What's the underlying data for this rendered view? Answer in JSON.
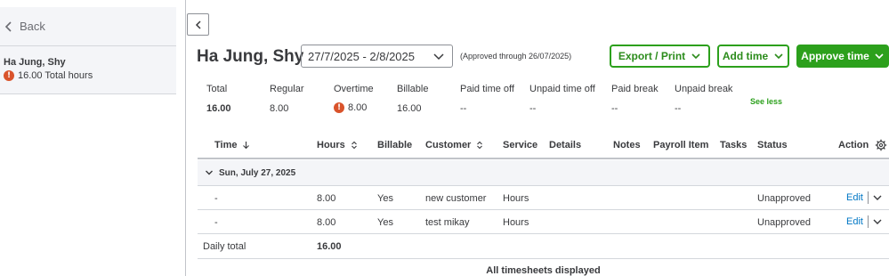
{
  "sidebar": {
    "back_label": "Back",
    "employee": {
      "name": "Ha Jung, Shy",
      "hours": "16.00 Total hours"
    }
  },
  "header": {
    "title": "Ha Jung, Shy",
    "date_range": "27/7/2025 - 2/8/2025",
    "approved_note": "(Approved through 26/07/2025)",
    "export_label": "Export / Print",
    "add_time_label": "Add time",
    "approve_label": "Approve time"
  },
  "summary": {
    "items": [
      {
        "label": "Total",
        "value": "16.00"
      },
      {
        "label": "Regular",
        "value": "8.00"
      },
      {
        "label": "Overtime",
        "value": "8.00"
      },
      {
        "label": "Billable",
        "value": "16.00"
      },
      {
        "label": "Paid time off",
        "value": "--"
      },
      {
        "label": "Unpaid time off",
        "value": "--"
      },
      {
        "label": "Paid break",
        "value": "--"
      },
      {
        "label": "Unpaid break",
        "value": "--"
      }
    ],
    "see_less": "See less"
  },
  "table": {
    "columns": [
      "Time",
      "Hours",
      "Billable",
      "Customer",
      "Service",
      "Details",
      "Notes",
      "Payroll Item",
      "Tasks",
      "Status",
      "Action"
    ],
    "group_label": "Sun, July 27, 2025",
    "rows": [
      {
        "time": "-",
        "hours": "8.00",
        "billable": "Yes",
        "customer": "new customer",
        "service": "Hours",
        "status": "Unapproved",
        "action": "Edit"
      },
      {
        "time": "-",
        "hours": "8.00",
        "billable": "Yes",
        "customer": "test mikay",
        "service": "Hours",
        "status": "Unapproved",
        "action": "Edit"
      }
    ],
    "daily_total_label": "Daily total",
    "daily_total_value": "16.00"
  },
  "footer": "All timesheets displayed",
  "colors": {
    "accent": "#2ca01c",
    "link": "#0077c5",
    "warning": "#d9532b",
    "text": "#393a3d"
  },
  "icons": [
    "chevron-left-icon",
    "warning-icon",
    "chevron-down-icon",
    "sort-down-icon",
    "sort-updown-icon",
    "gear-icon"
  ]
}
